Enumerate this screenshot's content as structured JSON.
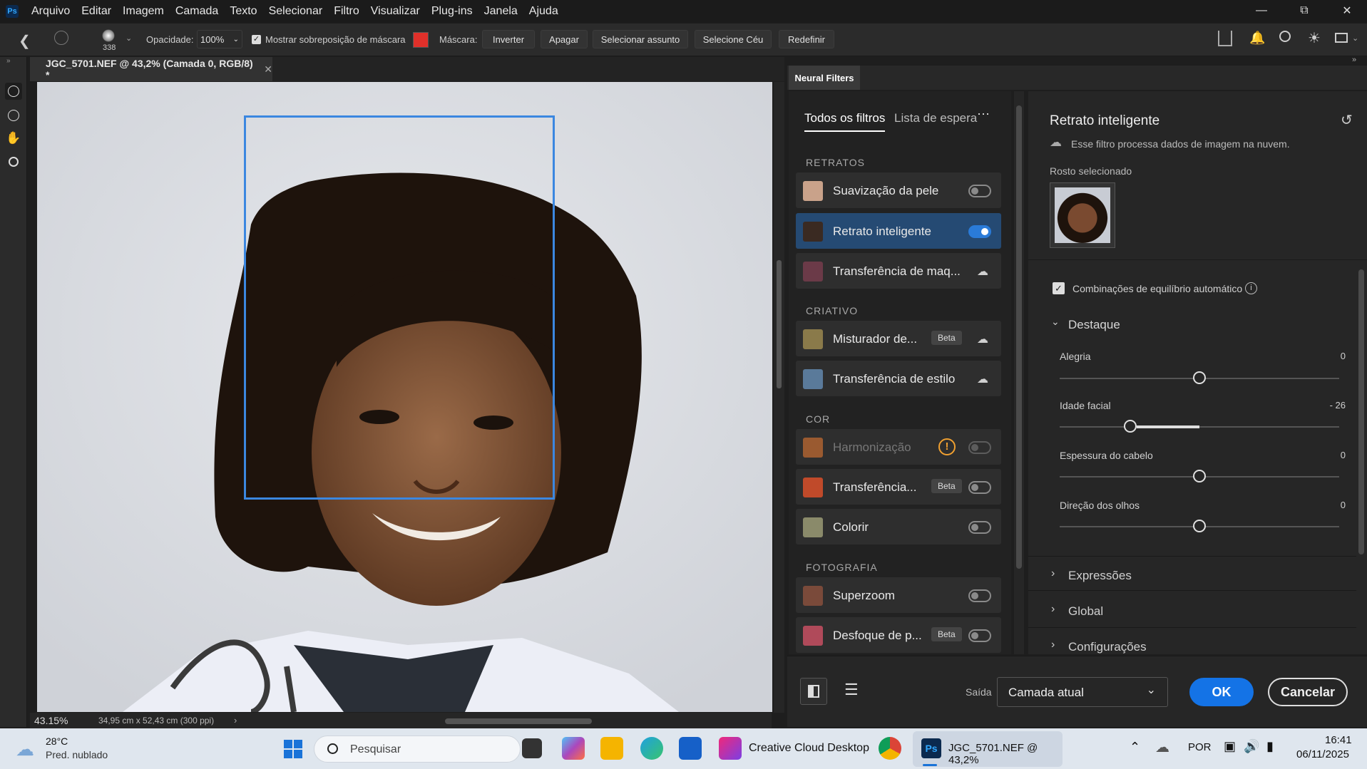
{
  "menu": [
    "Arquivo",
    "Editar",
    "Imagem",
    "Camada",
    "Texto",
    "Selecionar",
    "Filtro",
    "Visualizar",
    "Plug-ins",
    "Janela",
    "Ajuda"
  ],
  "options": {
    "brush_size": "338",
    "opacity_label": "Opacidade:",
    "opacity_value": "100%",
    "mask_overlay_label": "Mostrar sobreposição de máscara",
    "mask_label": "Máscara:",
    "mask_color": "#e0302a",
    "buttons": [
      "Inverter",
      "Apagar",
      "Selecionar assunto",
      "Selecione Céu",
      "Redefinir"
    ]
  },
  "document": {
    "tab_title": "JGC_5701.NEF @ 43,2% (Camada 0, RGB/8) *",
    "zoom": "43.15%",
    "doc_info": "34,95 cm x 52,43 cm (300 ppi)"
  },
  "neural": {
    "panel_title": "Neural Filters",
    "tabs": [
      "Todos os filtros",
      "Lista de espera"
    ],
    "sections": {
      "retratos": "RETRATOS",
      "criativo": "CRIATIVO",
      "cor": "COR",
      "fotografia": "FOTOGRAFIA"
    },
    "filters": [
      {
        "label": "Suavização da pele"
      },
      {
        "label": "Retrato inteligente"
      },
      {
        "label": "Transferência de maq..."
      },
      {
        "label": "Misturador de...",
        "badge": "Beta"
      },
      {
        "label": "Transferência de estilo"
      },
      {
        "label": "Harmonização"
      },
      {
        "label": "Transferência...",
        "badge": "Beta"
      },
      {
        "label": "Colorir"
      },
      {
        "label": "Superzoom"
      },
      {
        "label": "Desfoque de p...",
        "badge": "Beta"
      }
    ],
    "detail": {
      "title": "Retrato inteligente",
      "cloud_note": "Esse filtro processa dados de imagem na nuvem.",
      "face_label": "Rosto selecionado",
      "auto_balance": "Combinações de equilíbrio automático",
      "group_destaque": "Destaque",
      "sliders": [
        {
          "label": "Alegria",
          "value": "0"
        },
        {
          "label": "Idade facial",
          "value": "- 26"
        },
        {
          "label": "Espessura do cabelo",
          "value": "0"
        },
        {
          "label": "Direção dos olhos",
          "value": "0"
        }
      ],
      "groups": [
        "Expressões",
        "Global",
        "Configurações"
      ]
    },
    "output_label": "Saída",
    "output_value": "Camada atual",
    "ok": "OK",
    "cancel": "Cancelar"
  },
  "taskbar": {
    "temp": "28°C",
    "weather": "Pred. nublado",
    "search": "Pesquisar",
    "cc_label": "Creative Cloud Desktop",
    "ps_label": "JGC_5701.NEF @ 43,2%",
    "lang": "POR",
    "time": "16:41",
    "date": "06/11/2025"
  }
}
